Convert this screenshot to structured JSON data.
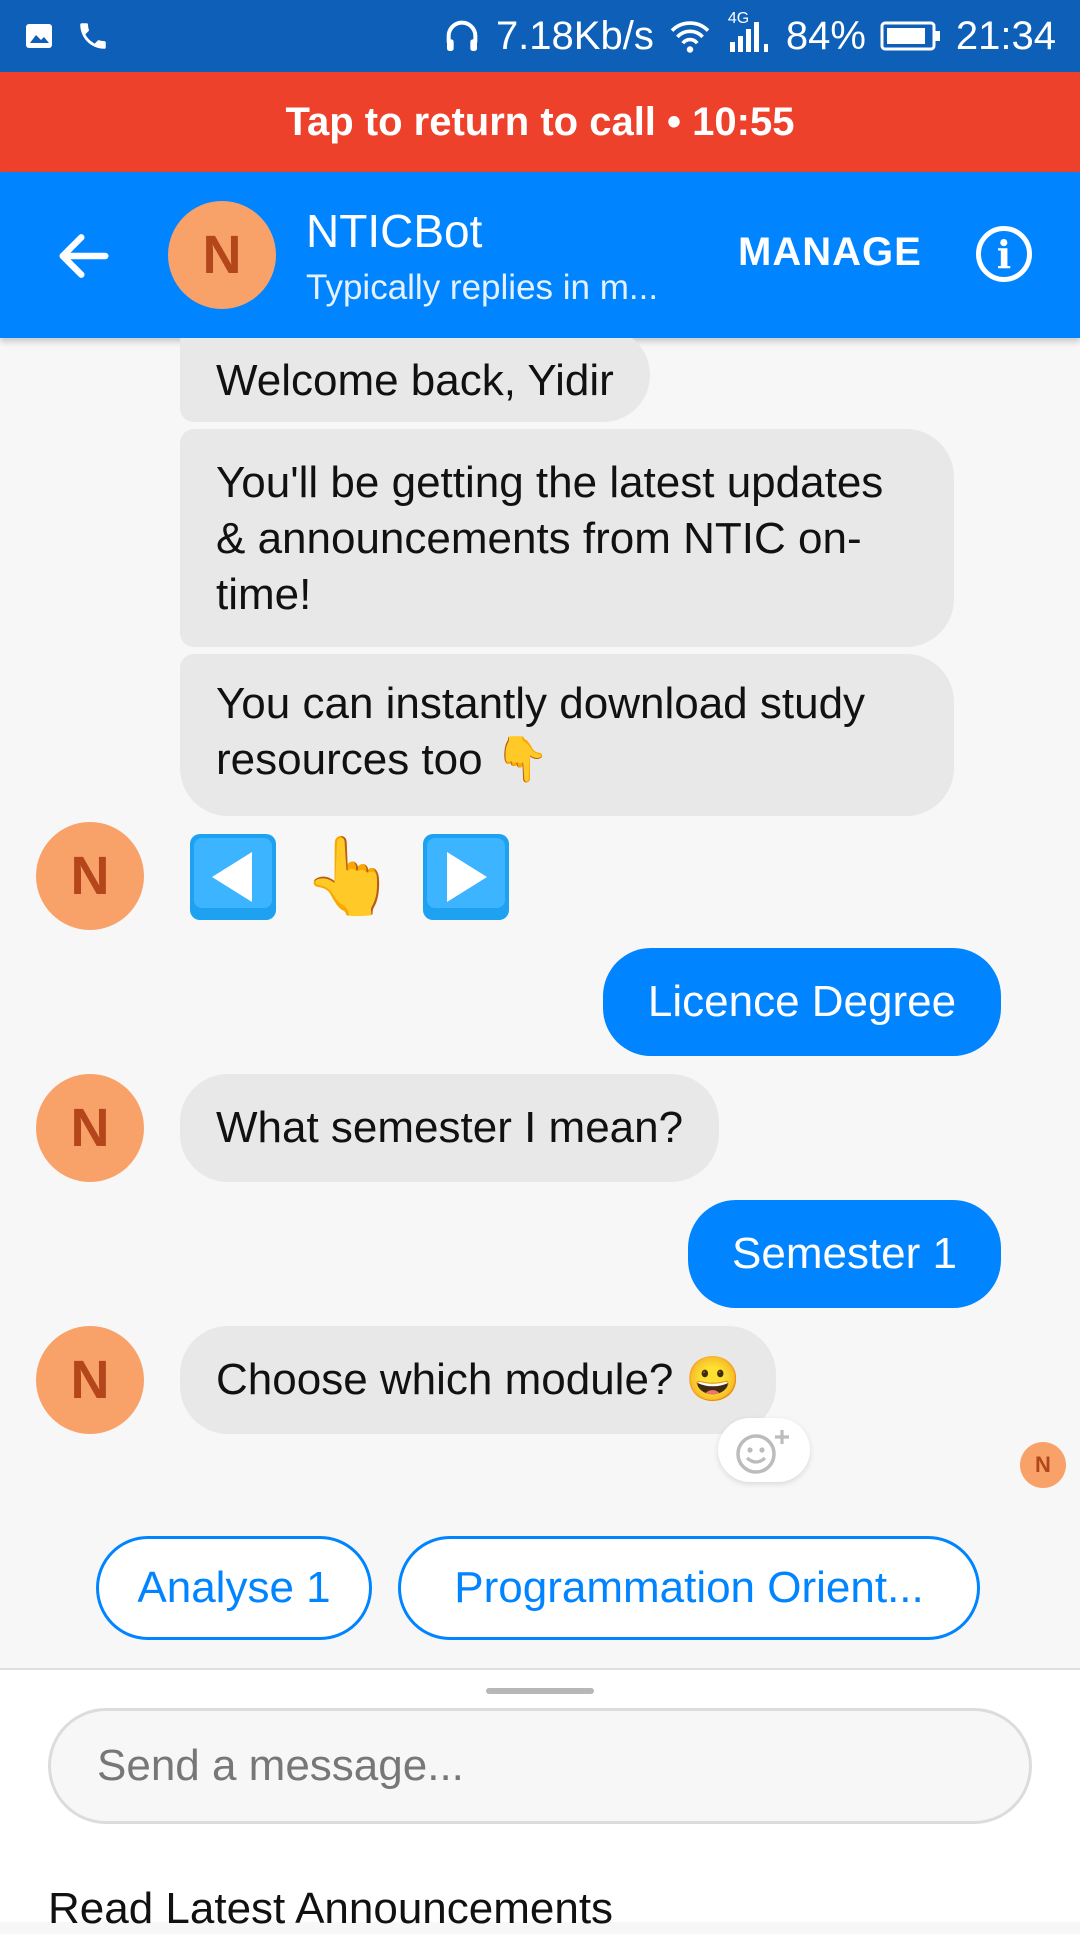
{
  "status_bar": {
    "net_speed": "7.18Kb/s",
    "network": "4G",
    "battery": "84%",
    "time": "21:34"
  },
  "call_banner": {
    "text": "Tap to return to call • 10:55"
  },
  "header": {
    "avatar_letter": "N",
    "title": "NTICBot",
    "subtitle": "Typically replies in m...",
    "manage_label": "MANAGE",
    "info_icon": "i"
  },
  "messages": [
    {
      "text": "Welcome back, Yidir",
      "from": "bot"
    },
    {
      "text": "You'll be getting the latest updates & announcements from NTIC on-time!",
      "from": "bot"
    },
    {
      "text": "You can instantly download study resources too 👇",
      "from": "bot"
    },
    {
      "text": "Licence Degree",
      "from": "user"
    },
    {
      "text": "What semester I mean?",
      "from": "bot"
    },
    {
      "text": "Semester 1",
      "from": "user"
    },
    {
      "text": "Choose which module? 😀",
      "from": "bot"
    }
  ],
  "avatar_letter": "N",
  "emoji_row": [
    "◀️",
    "👆",
    "▶️"
  ],
  "quick_replies": [
    "Analyse 1",
    "Programmation Orient..."
  ],
  "composer": {
    "placeholder": "Send a message..."
  },
  "persistent_menu": {
    "label": "Read Latest Announcements"
  },
  "colors": {
    "accent": "#0084ff",
    "status_bar": "#0d5fb8",
    "call_banner": "#ee412b",
    "avatar": "#f8a26a"
  }
}
